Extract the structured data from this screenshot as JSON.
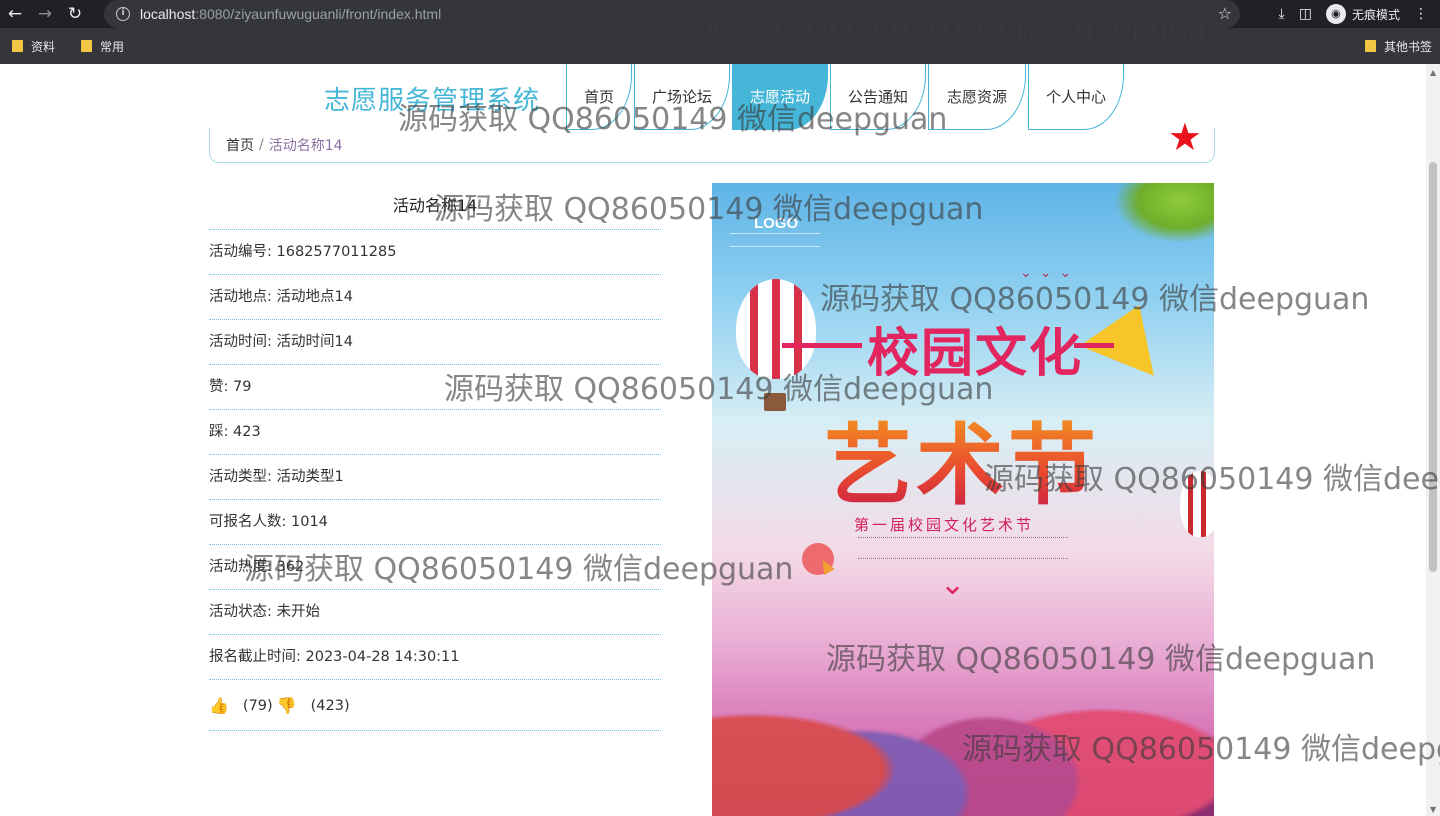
{
  "browser": {
    "url_host": "localhost",
    "url_rest": ":8080/ziyaunfuwuguanli/front/index.html",
    "incognito_label": "无痕模式"
  },
  "bookmarks": {
    "items": [
      "资料",
      "常用"
    ],
    "other": "其他书签"
  },
  "site": {
    "title": "志愿服务管理系统"
  },
  "nav": {
    "items": [
      {
        "label": "首页",
        "active": false
      },
      {
        "label": "广场论坛",
        "active": false
      },
      {
        "label": "志愿活动",
        "active": true
      },
      {
        "label": "公告通知",
        "active": false
      },
      {
        "label": "志愿资源",
        "active": false
      },
      {
        "label": "个人中心",
        "active": false
      }
    ]
  },
  "breadcrumb": {
    "home": "首页",
    "sep": "/",
    "current": "活动名称14"
  },
  "detail": {
    "title": "活动名称14",
    "rows": [
      {
        "label": "活动编号",
        "value": "1682577011285"
      },
      {
        "label": "活动地点",
        "value": "活动地点14"
      },
      {
        "label": "活动时间",
        "value": "活动时间14"
      },
      {
        "label": "赞",
        "value": "79"
      },
      {
        "label": "踩",
        "value": "423"
      },
      {
        "label": "活动类型",
        "value": "活动类型1"
      },
      {
        "label": "可报名人数",
        "value": "1014"
      },
      {
        "label": "活动热度",
        "value": "362"
      },
      {
        "label": "活动状态",
        "value": "未开始"
      },
      {
        "label": "报名截止时间",
        "value": "2023-04-28 14:30:11"
      }
    ],
    "like_count": "(79)",
    "dislike_count": "(423)"
  },
  "poster": {
    "logo": "LOGO",
    "headline": "校园文化",
    "main": "艺术节",
    "subtitle": "第一届校园文化艺术节"
  },
  "watermark": "源码获取 QQ86050149 微信deepguan",
  "colors": {
    "accent": "#45b6d7",
    "favorite": "#e8131b",
    "thumb": "#e04848"
  }
}
